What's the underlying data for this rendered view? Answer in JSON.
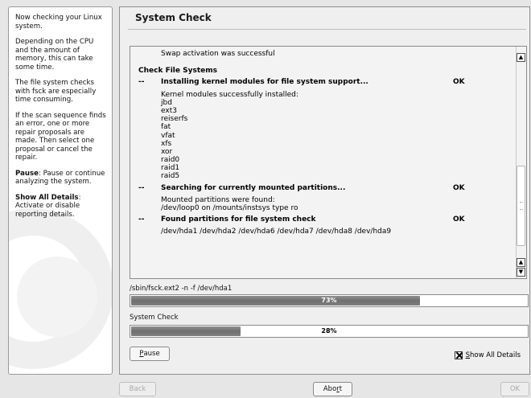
{
  "help": {
    "p1": "Now checking your Linux system.",
    "p2": "Depending on the CPU and the amount of memory, this can take some time.",
    "p3": "The file system checks with fsck are especially time consuming.",
    "p4": "If the scan sequence finds an error, one or more repair proposals are made. Then select one proposal or cancel the repair.",
    "p5_bold": "Pause",
    "p5_rest": ": Pause or continue analyzing the system.",
    "p6_bold": "Show All Details",
    "p6_rest": ": Activate or disable reporting details."
  },
  "title": "System Check",
  "log": {
    "swap_msg": "Swap activation was successful",
    "section": "Check File Systems",
    "dash": "--",
    "task1": {
      "label": "Installing kernel modules for file system support...",
      "status": "OK"
    },
    "task1_details": [
      "Kernel modules successfully installed:",
      "jbd",
      "ext3",
      "reiserfs",
      "fat",
      "vfat",
      "xfs",
      "xor",
      "raid0",
      "raid1",
      "raid5"
    ],
    "task2": {
      "label": "Searching for currently mounted partitions...",
      "status": "OK"
    },
    "task2_details": [
      "Mounted partitions were found:",
      "/dev/loop0 on /mounts/instsys type ro"
    ],
    "task3": {
      "label": "Found partitions for file system check",
      "status": "OK"
    },
    "task3_details": [
      "/dev/hda1 /dev/hda2 /dev/hda6 /dev/hda7 /dev/hda8 /dev/hda9"
    ]
  },
  "progress1": {
    "label": "/sbin/fsck.ext2 -n -f /dev/hda1",
    "percent": 73,
    "text": "73%"
  },
  "progress2": {
    "label": "System Check",
    "percent": 28,
    "text": "28%"
  },
  "pause": {
    "u": "P",
    "rest": "ause"
  },
  "show_details": {
    "u": "S",
    "rest": "how All Details",
    "checked": true
  },
  "buttons": {
    "back": "Back",
    "abort_pre": "Abo",
    "abort_u": "r",
    "abort_post": "t",
    "ok": "OK"
  }
}
